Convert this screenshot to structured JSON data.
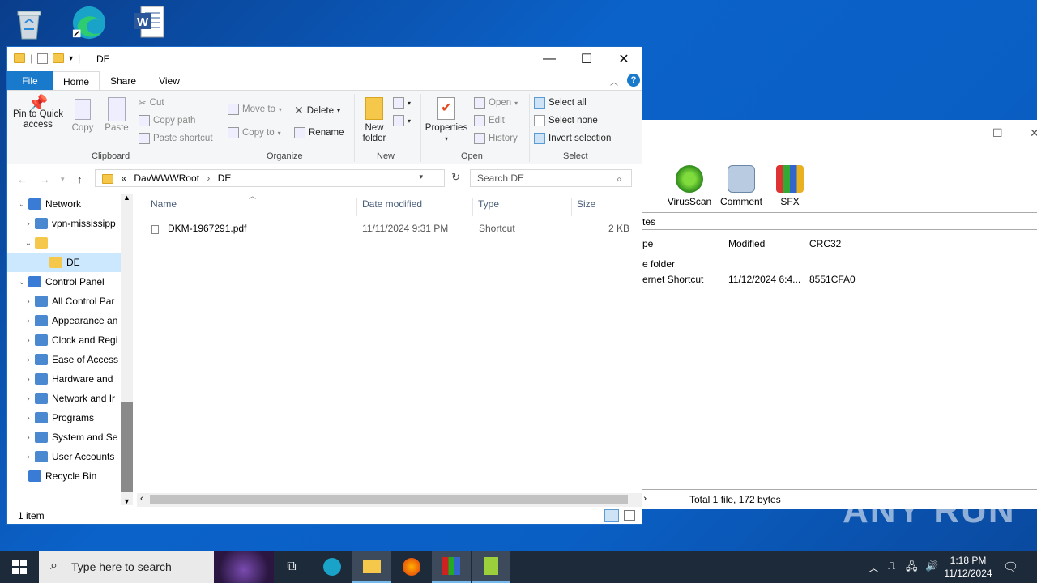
{
  "desktop": {
    "icons": [
      "Recycle Bin",
      "Microsoft Edge",
      "Word"
    ]
  },
  "explorer": {
    "title": "DE",
    "window_controls": {
      "minimize": "—",
      "maximize": "☐",
      "close": "✕"
    },
    "tabs": [
      "File",
      "Home",
      "Share",
      "View"
    ],
    "ribbon": {
      "clipboard": {
        "label": "Clipboard",
        "pin": "Pin to Quick access",
        "copy": "Copy",
        "paste": "Paste",
        "cut": "Cut",
        "copy_path": "Copy path",
        "paste_shortcut": "Paste shortcut"
      },
      "organize": {
        "label": "Organize",
        "move_to": "Move to",
        "copy_to": "Copy to",
        "delete": "Delete",
        "rename": "Rename"
      },
      "new": {
        "label": "New",
        "new_folder": "New folder"
      },
      "open": {
        "label": "Open",
        "properties": "Properties",
        "open": "Open",
        "edit": "Edit",
        "history": "History"
      },
      "select": {
        "label": "Select",
        "select_all": "Select all",
        "select_none": "Select none",
        "invert": "Invert selection"
      }
    },
    "address": {
      "prefix": "«",
      "path": [
        "DavWWWRoot",
        "DE"
      ]
    },
    "search": {
      "placeholder": "Search DE"
    },
    "nav": [
      {
        "label": "Network",
        "level": 0,
        "expanded": true
      },
      {
        "label": "vpn-mississipp",
        "level": 1
      },
      {
        "label": "",
        "level": 1,
        "expanded": true
      },
      {
        "label": "DE",
        "level": 2,
        "selected": true
      },
      {
        "label": "Control Panel",
        "level": 0,
        "expanded": true
      },
      {
        "label": "All Control Par",
        "level": 1
      },
      {
        "label": "Appearance an",
        "level": 1
      },
      {
        "label": "Clock and Regi",
        "level": 1
      },
      {
        "label": "Ease of Access",
        "level": 1
      },
      {
        "label": "Hardware and",
        "level": 1
      },
      {
        "label": "Network and Ir",
        "level": 1
      },
      {
        "label": "Programs",
        "level": 1
      },
      {
        "label": "System and Se",
        "level": 1
      },
      {
        "label": "User Accounts",
        "level": 1
      },
      {
        "label": "Recycle Bin",
        "level": 0
      }
    ],
    "columns": [
      "Name",
      "Date modified",
      "Type",
      "Size"
    ],
    "files": [
      {
        "name": "DKM-1967291.pdf",
        "date": "11/11/2024 9:31 PM",
        "type": "Shortcut",
        "size": "2 KB"
      }
    ],
    "status": "1 item"
  },
  "winrar": {
    "tools": [
      "VirusScan",
      "Comment",
      "SFX"
    ],
    "path_fragment": "tes",
    "columns": [
      "pe",
      "Modified",
      "CRC32"
    ],
    "rows": [
      {
        "type": "e folder",
        "modified": "",
        "crc": ""
      },
      {
        "type": "ernet Shortcut",
        "modified": "11/12/2024 6:4...",
        "crc": "8551CFA0"
      }
    ],
    "status": "Total 1 file, 172 bytes"
  },
  "taskbar": {
    "search_placeholder": "Type here to search",
    "time": "1:18 PM",
    "date": "11/12/2024"
  },
  "watermark": "ANY RUN"
}
